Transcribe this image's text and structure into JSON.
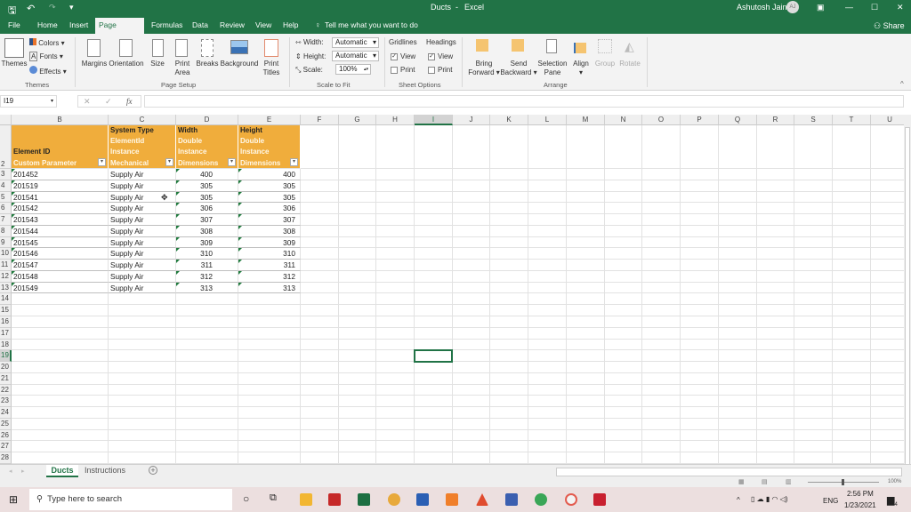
{
  "window": {
    "doc_title": "Ducts",
    "app": "Excel",
    "separator": "-",
    "user": "Ashutosh Jain",
    "avatar": "AJ",
    "share": "Share"
  },
  "quick_access": [
    "save-icon",
    "undo-icon",
    "redo-icon",
    "customize-icon"
  ],
  "tabs": [
    {
      "label": "File"
    },
    {
      "label": "Home"
    },
    {
      "label": "Insert"
    },
    {
      "label": "Page Layout",
      "active": true
    },
    {
      "label": "Formulas"
    },
    {
      "label": "Data"
    },
    {
      "label": "Review"
    },
    {
      "label": "View"
    },
    {
      "label": "Help"
    }
  ],
  "tell_me": "Tell me what you want to do",
  "ribbon": {
    "themes": {
      "themes": "Themes",
      "colors": "Colors",
      "fonts": "Fonts",
      "effects": "Effects",
      "group": "Themes"
    },
    "page_setup": {
      "margins": "Margins",
      "orientation": "Orientation",
      "size": "Size",
      "print_area_1": "Print",
      "print_area_2": "Area",
      "breaks": "Breaks",
      "background": "Background",
      "print_titles_1": "Print",
      "print_titles_2": "Titles",
      "group": "Page Setup"
    },
    "scale": {
      "width_label": "Width:",
      "width_value": "Automatic",
      "height_label": "Height:",
      "height_value": "Automatic",
      "scale_label": "Scale:",
      "scale_value": "100%",
      "group": "Scale to Fit"
    },
    "sheet_options": {
      "gridlines": "Gridlines",
      "headings": "Headings",
      "view": "View",
      "print": "Print",
      "gridlines_view": true,
      "gridlines_print": false,
      "headings_view": true,
      "headings_print": false,
      "group": "Sheet Options"
    },
    "arrange": {
      "bring_1": "Bring",
      "bring_2": "Forward",
      "send_1": "Send",
      "send_2": "Backward",
      "sel_1": "Selection",
      "sel_2": "Pane",
      "align": "Align",
      "group_btn": "Group",
      "rotate": "Rotate",
      "group": "Arrange"
    }
  },
  "formula_bar": {
    "name_box": "I19",
    "cancel": "✕",
    "enter": "✓",
    "fx": "fx",
    "value": ""
  },
  "columns": [
    "B",
    "C",
    "D",
    "E",
    "F",
    "G",
    "H",
    "I",
    "J",
    "K",
    "L",
    "M",
    "N",
    "O",
    "P",
    "Q",
    "R",
    "S",
    "T",
    "U"
  ],
  "selected_cell": "I19",
  "table": {
    "headers": [
      {
        "lines": [
          "",
          "",
          "Element ID",
          "Custom Parameter"
        ]
      },
      {
        "lines": [
          "System Type",
          "ElementId",
          "Instance",
          "Mechanical"
        ]
      },
      {
        "lines": [
          "Width",
          "Double",
          "Instance",
          "Dimensions"
        ]
      },
      {
        "lines": [
          "Height",
          "Double",
          "Instance",
          "Dimensions"
        ]
      }
    ],
    "rows": [
      [
        "201452",
        "Supply Air",
        "400",
        "400"
      ],
      [
        "201519",
        "Supply Air",
        "305",
        "305"
      ],
      [
        "201541",
        "Supply Air",
        "305",
        "305"
      ],
      [
        "201542",
        "Supply Air",
        "306",
        "306"
      ],
      [
        "201543",
        "Supply Air",
        "307",
        "307"
      ],
      [
        "201544",
        "Supply Air",
        "308",
        "308"
      ],
      [
        "201545",
        "Supply Air",
        "309",
        "309"
      ],
      [
        "201546",
        "Supply Air",
        "310",
        "310"
      ],
      [
        "201547",
        "Supply Air",
        "311",
        "311"
      ],
      [
        "201548",
        "Supply Air",
        "312",
        "312"
      ],
      [
        "201549",
        "Supply Air",
        "313",
        "313"
      ]
    ]
  },
  "row_numbers": [
    "2",
    "3",
    "4",
    "5",
    "6",
    "7",
    "8",
    "9",
    "10",
    "11",
    "12",
    "13",
    "14",
    "15",
    "16",
    "17",
    "18",
    "19",
    "20",
    "21",
    "22",
    "23",
    "24",
    "25",
    "26",
    "27",
    "28"
  ],
  "sheet_tabs": [
    {
      "label": "Ducts",
      "active": true
    },
    {
      "label": "Instructions"
    }
  ],
  "status": {
    "zoom": "100%"
  },
  "taskbar": {
    "search_placeholder": "Type here to search",
    "lang": "ENG",
    "time": "2:56 PM",
    "date": "1/23/2021",
    "notifications": "4"
  },
  "colors": {
    "excel_green": "#217346",
    "header_orange": "#f0ad3c"
  }
}
